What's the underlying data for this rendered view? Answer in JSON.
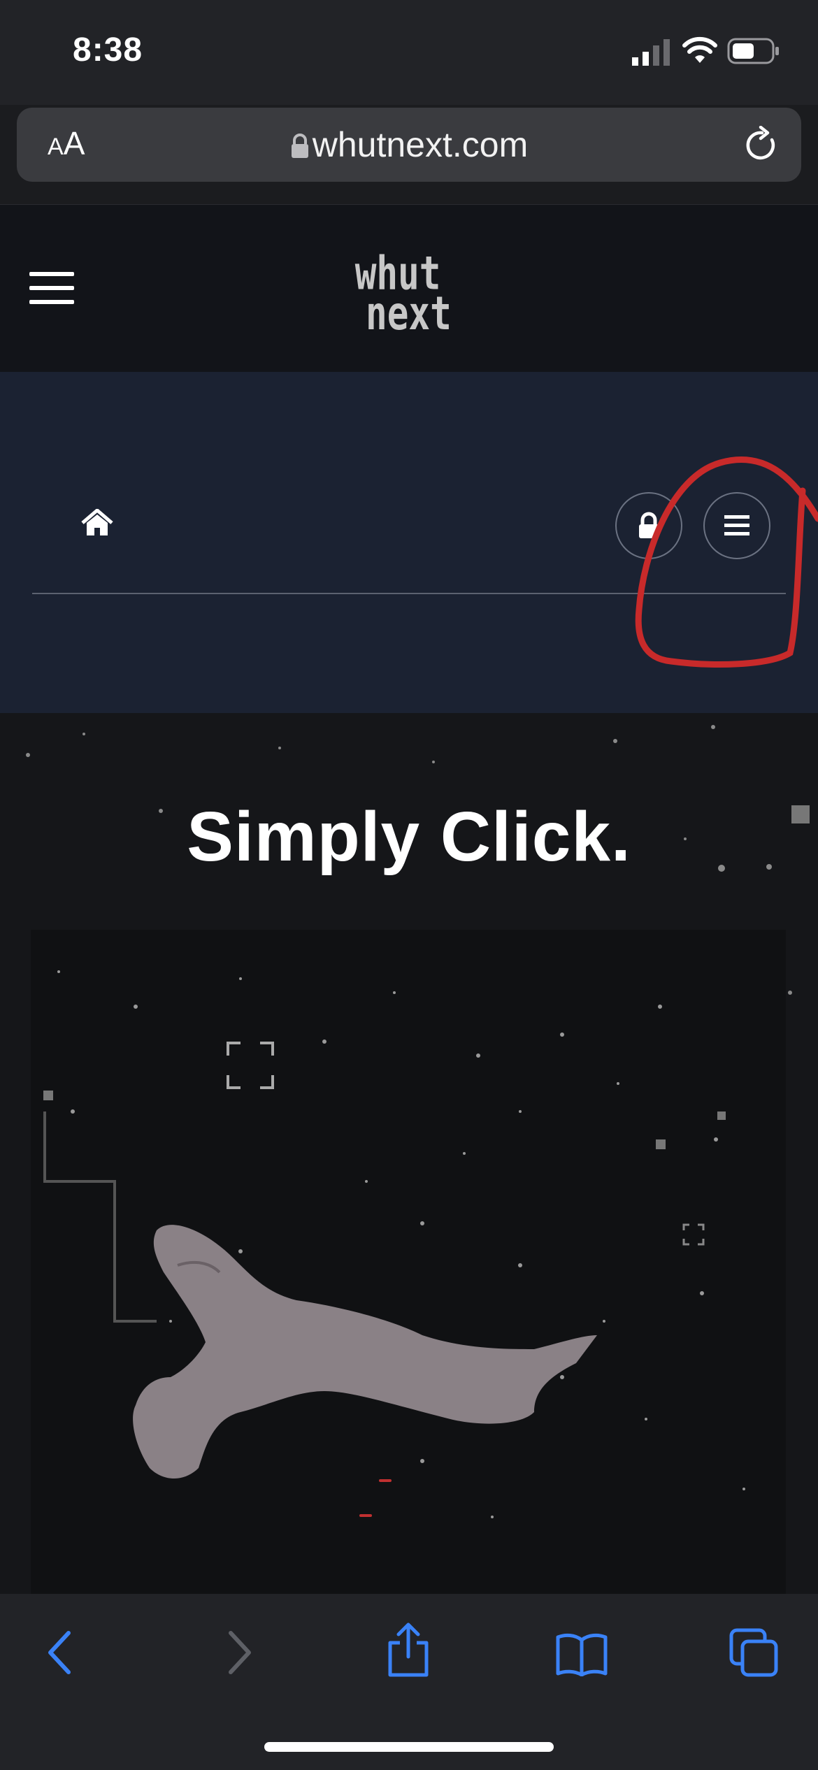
{
  "status": {
    "time": "8:38"
  },
  "browser": {
    "aa": "AA",
    "url": "whutnext.com"
  },
  "site": {
    "logo_top": "whut",
    "logo_bottom": "next"
  },
  "hero": {
    "title": "Simply Click."
  },
  "colors": {
    "accent_blue": "#3a82f7",
    "annotation_red": "#c82a2a"
  }
}
